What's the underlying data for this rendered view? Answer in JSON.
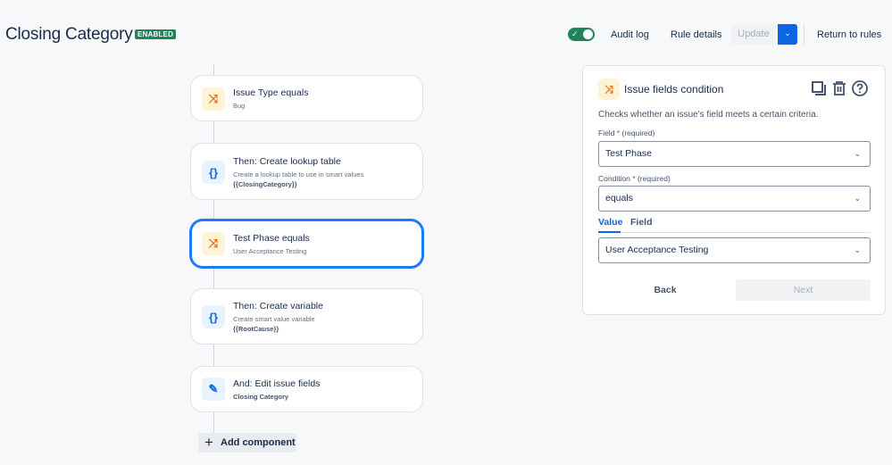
{
  "header": {
    "title": "Closing Category",
    "status_badge": "ENABLED",
    "toggle_enabled": true,
    "audit_log": "Audit log",
    "rule_details": "Rule details",
    "update": "Update",
    "return_to_rules": "Return to rules"
  },
  "flow": {
    "components": [
      {
        "type": "condition",
        "icon": "shuffle-icon",
        "title": "Issue Type equals",
        "subtitle": "Bug",
        "detail": ""
      },
      {
        "type": "action",
        "icon": "braces-icon",
        "title": "Then: Create lookup table",
        "subtitle": "Create a lookup table to use in smart values",
        "detail": "{{ClosingCategory}}"
      },
      {
        "type": "condition",
        "icon": "shuffle-icon",
        "title": "Test Phase equals",
        "subtitle": "User Acceptance Testing",
        "detail": "",
        "selected": true
      },
      {
        "type": "action",
        "icon": "braces-icon",
        "title": "Then: Create variable",
        "subtitle": "Create smart value variable",
        "detail": "{{RootCause}}"
      },
      {
        "type": "action",
        "icon": "pencil-icon",
        "title": "And: Edit issue fields",
        "subtitle": "",
        "detail": "Closing Category"
      }
    ],
    "add_component": "Add component"
  },
  "panel": {
    "title": "Issue fields condition",
    "description": "Checks whether an issue's field meets a certain criteria.",
    "field_label": "Field",
    "field_required": "(required)",
    "field_value": "Test Phase",
    "condition_label": "Condition",
    "condition_required": "(required)",
    "condition_value": "equals",
    "tabs": [
      "Value",
      "Field"
    ],
    "active_tab": "Value",
    "value_value": "User Acceptance Testing",
    "back": "Back",
    "next": "Next"
  },
  "colors": {
    "accent": "#0c66e4",
    "enabled": "#1f845a",
    "condition_icon": "#e56910"
  }
}
